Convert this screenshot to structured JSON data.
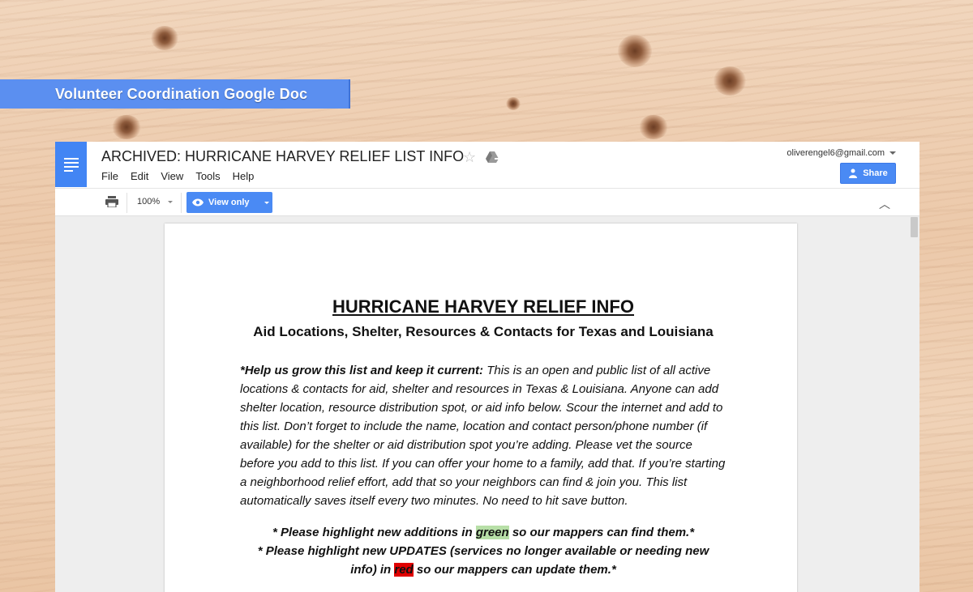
{
  "banner": {
    "label": "Volunteer Coordination Google Doc"
  },
  "doc": {
    "title": "ARCHIVED: HURRICANE HARVEY RELIEF LIST INFO",
    "menus": [
      "File",
      "Edit",
      "View",
      "Tools",
      "Help"
    ],
    "account": "oliverengel6@gmail.com",
    "share_label": "Share"
  },
  "toolbar": {
    "zoom": "100%",
    "mode": "View only"
  },
  "icons": {
    "doc": "docs-menu-icon",
    "star": "star-icon",
    "drive": "move-to-drive-icon",
    "print": "print-icon",
    "eye": "eye-icon",
    "collapse": "chevron-up-icon",
    "share": "person-add-icon"
  },
  "colors": {
    "accent": "#4a8af4",
    "banner": "#5b8ff0",
    "green_highlight": "#b7dfa7",
    "red_highlight": "#e00000"
  },
  "content": {
    "heading": "HURRICANE HARVEY RELIEF INFO",
    "subheading": "Aid Locations, Shelter, Resources & Contacts for Texas and Louisiana",
    "intro_bold": "*Help us grow this list and keep it current:",
    "intro_text": " This is an open and public list of all active locations & contacts for aid, shelter and resources in Texas & Louisiana. Anyone can add shelter location, resource distribution spot, or aid info below. Scour the internet and add to this list. Don’t forget to include the name, location and contact person/phone number (if available) for the shelter or aid distribution spot you’re adding. Please vet the source before you add to this list. If you can offer your home to a family, add that. If you’re starting a neighborhood relief effort, add that so your neighbors can find & join you. This list automatically saves itself every two minutes. No need to hit save button.",
    "note1_pre": "* Please highlight new additions in ",
    "note1_hl": "green",
    "note1_post": " so our mappers can find them.*",
    "note2_pre": "* Please highlight new UPDATES (services no longer available or needing new info) in ",
    "note2_hl": "red",
    "note2_post": " so our mappers can update them.*"
  }
}
